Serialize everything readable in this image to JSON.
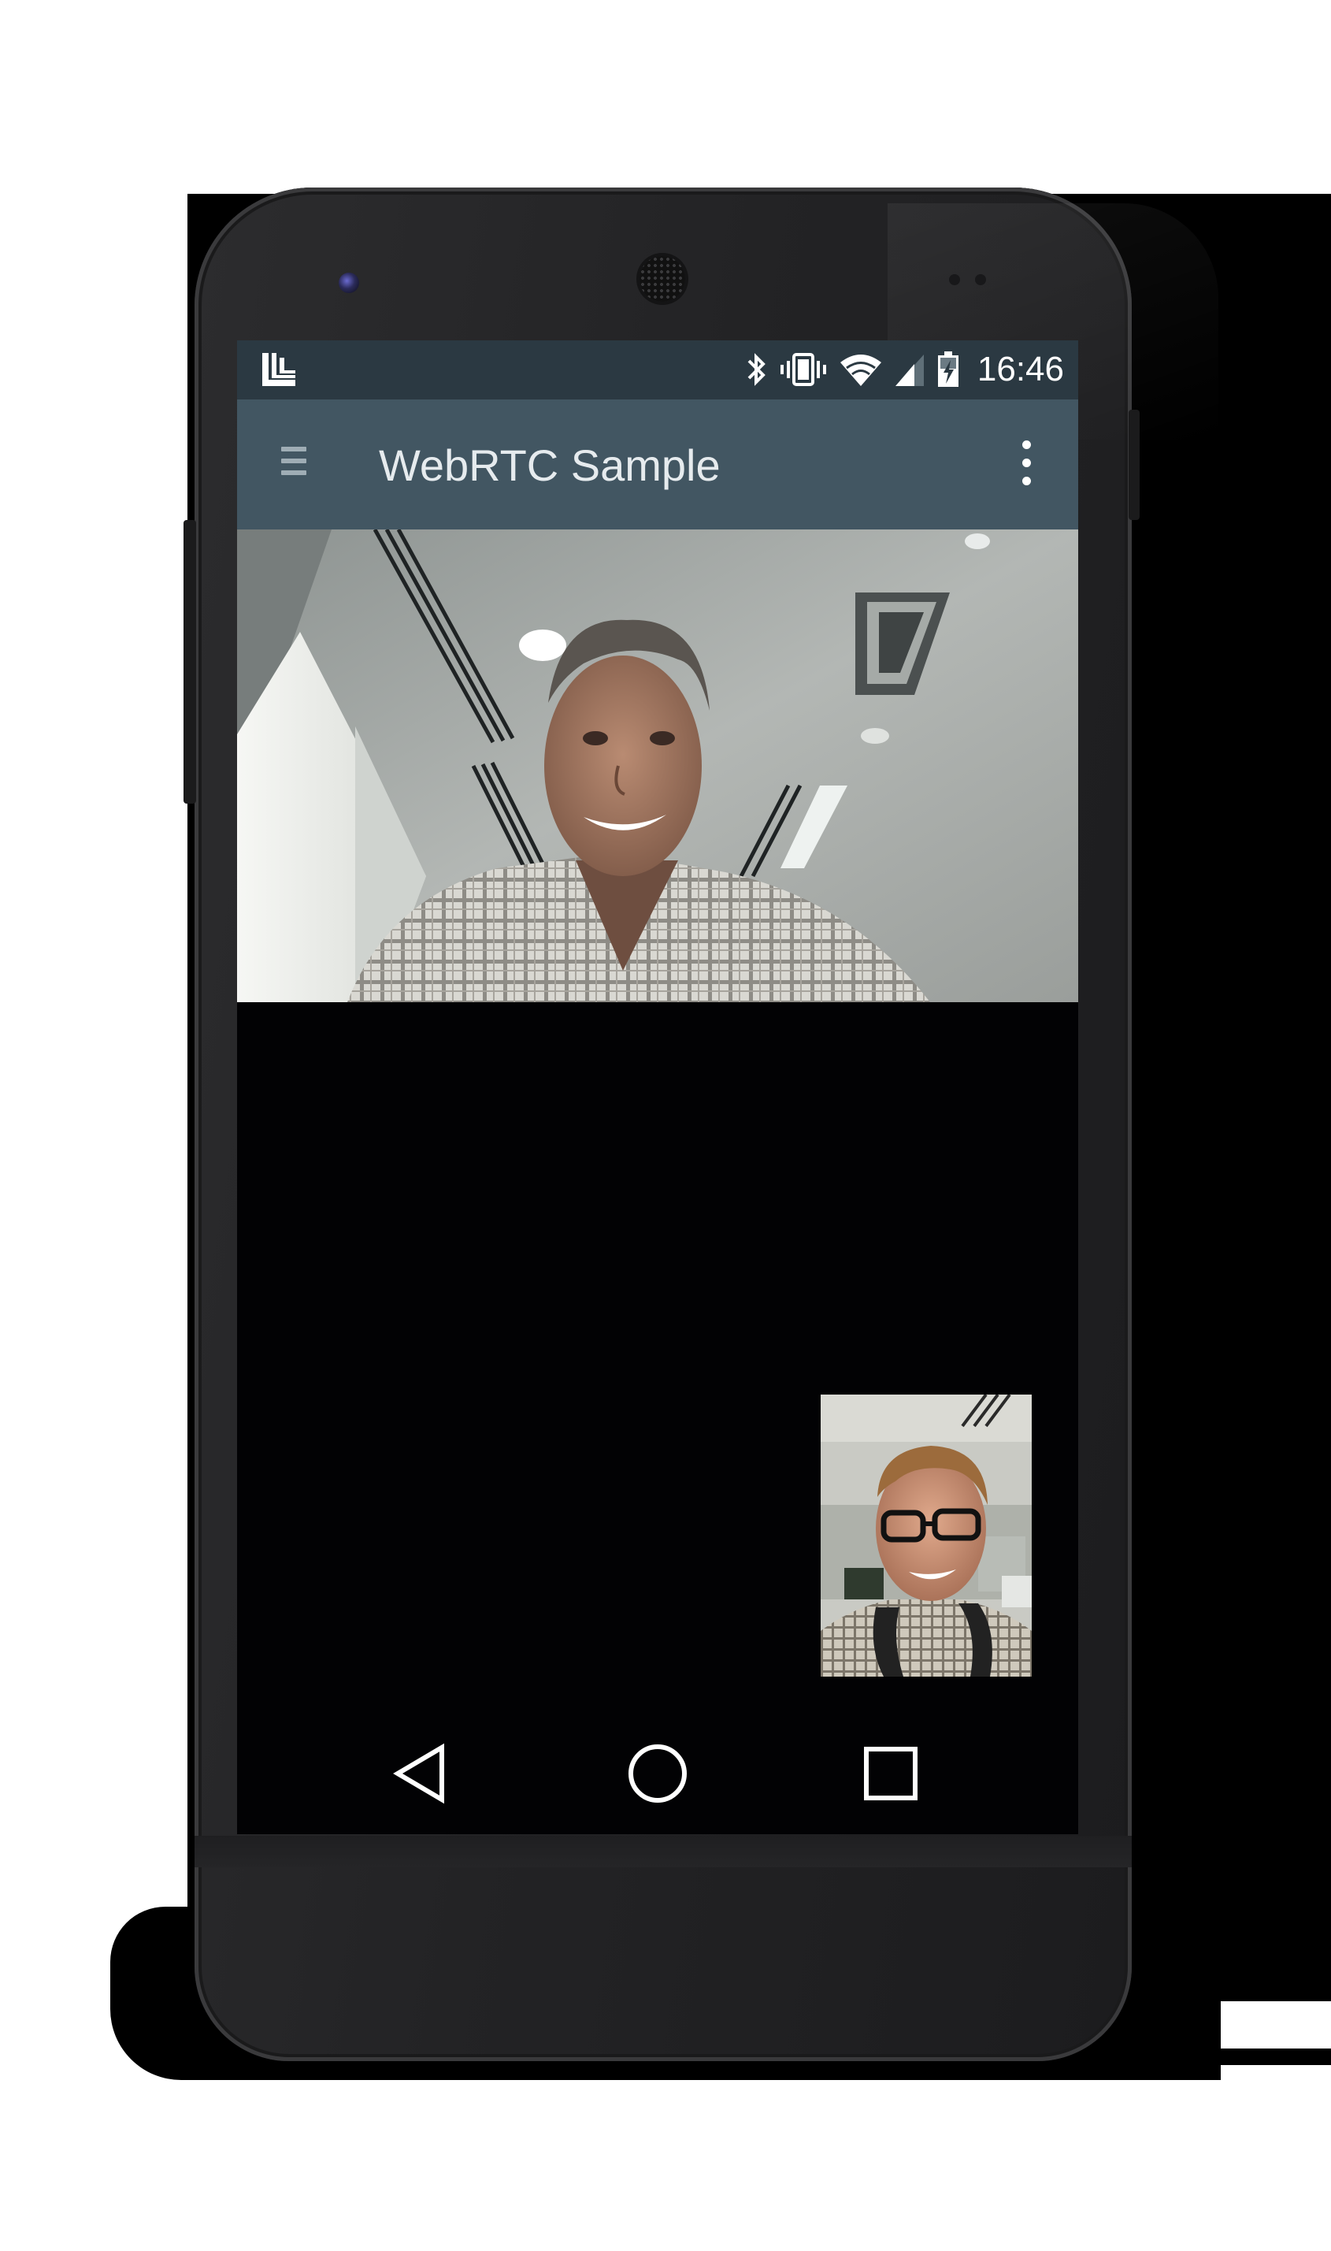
{
  "status_bar": {
    "app_icon": "launcher-logo-icon",
    "icons": [
      "bluetooth-icon",
      "vibrate-icon",
      "wifi-icon",
      "cell-signal-icon",
      "battery-charging-icon"
    ],
    "time": "16:46",
    "background_color": "#2b3942"
  },
  "app_bar": {
    "title": "WebRTC Sample",
    "menu_icon": "hamburger-menu-icon",
    "overflow_icon": "overflow-menu-icon",
    "background_color": "#425662"
  },
  "video_call": {
    "remote_video": "remote-participant-video",
    "local_video": "local-self-view-video"
  },
  "navigation_bar": {
    "buttons": [
      "back-icon",
      "home-icon",
      "recents-icon"
    ]
  },
  "device": {
    "frame_color": "#232325",
    "screen_color": "#020204"
  }
}
